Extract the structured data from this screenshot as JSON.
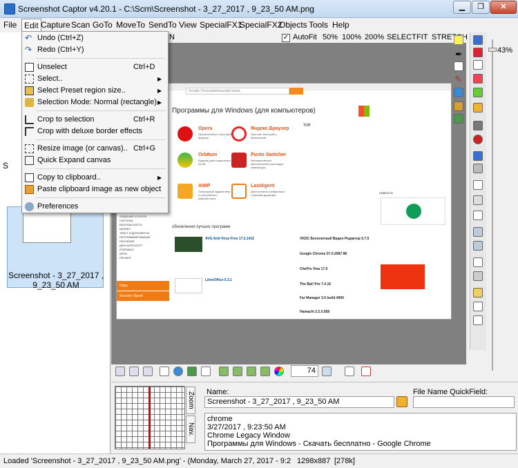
{
  "window": {
    "title": "Screenshot Captor v4.20.1 - C:\\Scrn\\Screenshot - 3_27_2017 , 9_23_50 AM.png",
    "controls": [
      "minimize",
      "restore",
      "close"
    ]
  },
  "menubar": {
    "items": [
      "File",
      "Edit",
      "Capture",
      "Scan",
      "GoTo",
      "MoveTo",
      "SendTo",
      "View",
      "SpecialFX1",
      "SpecialFX2",
      "Objects",
      "Tools",
      "Help"
    ],
    "active": "Edit"
  },
  "top_toolbar": {
    "autofit_label": "AutoFit",
    "autofit_checked": true,
    "zoom_options": [
      "50%",
      "100%",
      "200%",
      "SELECT",
      "FIT",
      "STRETCH"
    ],
    "left_fragment": "N"
  },
  "edit_menu": {
    "items": [
      {
        "label": "Undo (Ctrl+Z)",
        "shortcut": "",
        "icon": "undo-icon",
        "submenu": false
      },
      {
        "label": "Redo (Ctrl+Y)",
        "shortcut": "",
        "icon": "redo-icon",
        "submenu": false
      },
      {
        "label": "Unselect",
        "shortcut": "Ctrl+D",
        "icon": "unselect-icon",
        "submenu": false
      },
      {
        "label": "Select..",
        "shortcut": "",
        "icon": "select-icon",
        "submenu": true
      },
      {
        "label": "Select Preset region size..",
        "shortcut": "",
        "icon": "preset-region-icon",
        "submenu": true
      },
      {
        "label": "Selection Mode: Normal (rectangle)",
        "shortcut": "",
        "icon": "selection-mode-icon",
        "submenu": true
      },
      {
        "label": "Crop to selection",
        "shortcut": "Ctrl+R",
        "icon": "crop-icon",
        "submenu": false
      },
      {
        "label": "Crop with deluxe border effects",
        "shortcut": "",
        "icon": "crop-deluxe-icon",
        "submenu": false
      },
      {
        "label": "Resize image (or canvas)..",
        "shortcut": "Ctrl+G",
        "icon": "resize-icon",
        "submenu": false
      },
      {
        "label": "Quick Expand canvas",
        "shortcut": "",
        "icon": "expand-canvas-icon",
        "submenu": false
      },
      {
        "label": "Copy to clipboard..",
        "shortcut": "",
        "icon": "copy-icon",
        "submenu": true
      },
      {
        "label": "Paste clipboard image as new object",
        "shortcut": "",
        "icon": "paste-icon",
        "submenu": false
      },
      {
        "label": "Preferences",
        "shortcut": "",
        "icon": "preferences-icon",
        "submenu": false
      }
    ]
  },
  "thumbnail": {
    "caption_line1": "Screenshot - 3_27_2017 ,",
    "caption_line2": "9_23_50 AM",
    "side_fragment": "S"
  },
  "zoom": {
    "percent": "43%",
    "field_value": "74"
  },
  "captured_page": {
    "search_placeholder": "Google Пользовательский поиск",
    "heading": "Программы для Windows (для компьютеров)",
    "featured": [
      {
        "name": "Opera",
        "desc": "Оригинальные и быстрый браузер"
      },
      {
        "name": "Яндекс.Браузер",
        "desc": "Простой, быстрый и безопасный"
      },
      {
        "name": "Orbitum",
        "desc": "Браузер для социальных сетей"
      },
      {
        "name": "Punto Switcher",
        "desc": "Автоматическое переключение раскладки клавиатуры"
      },
      {
        "name": "AIMP",
        "desc": "Популярный аудиоплеер от российского разработчика"
      },
      {
        "name": "LastAgent",
        "desc": "Для контакта в избранном с вашими друзьями"
      }
    ],
    "top_label": "ТОП",
    "updates_heading": "обновления лучших программ",
    "updates": [
      {
        "name": "AVG Anti-Virus Free 17.2.1410"
      },
      {
        "name": "LibreOffice 5.3.1"
      }
    ],
    "right_list": [
      "IrfanView 4.44",
      "VKDC Бесплатный Видео Редактор 5.7.5",
      "Google Chrome 57.0.2987.98",
      "ChePrx Viva 17.9",
      "The Bat! Pro 7.4.16",
      "Far Manager 3.0 build 4900",
      "Hamachi 2.2.0.558"
    ],
    "side_menu": [
      "ОБЩЕНИЕ И ПОЧТА",
      "СИСТЕМА",
      "БЕЗОПАСНОСТЬ",
      "БИЗНЕС",
      "ТЕКСТ И ДОКУМЕНТЫ",
      "ПРОГРАММИРОВАНИЕ",
      "ОБУЧЕНИЕ",
      "ДЛЯ MICROSOFT",
      "PORTABLE",
      "ИГРЫ",
      "ПРОЧЕЕ"
    ],
    "orange_tabs": [
      "Игры",
      "Security Digest"
    ],
    "news_label": "НОВОСТИ"
  },
  "info_panel": {
    "name_label": "Name:",
    "name_value": "Screenshot - 3_27_2017 , 9_23_50 AM",
    "quickfield_label": "File Name QuickField:",
    "quickfield_value": "",
    "tab_zoom": "Zoom",
    "tab_nav": "Nav.",
    "details": [
      "chrome",
      "3/27/2017 , 9:23:50 AM",
      "Chrome Legacy Window",
      "Программы для Windows - Скачать бесплатно - Google Chrome"
    ]
  },
  "statusbar": {
    "message": "Loaded 'Screenshot - 3_27_2017 , 9_23_50 AM.png' - (Monday, March 27, 2017 - 9:2",
    "dimensions": "1298x887",
    "size": "[278k]"
  },
  "colors": {
    "accent_orange": "#f07a14",
    "selection_blue": "#cde3f7",
    "red_guide": "#dd0000"
  }
}
